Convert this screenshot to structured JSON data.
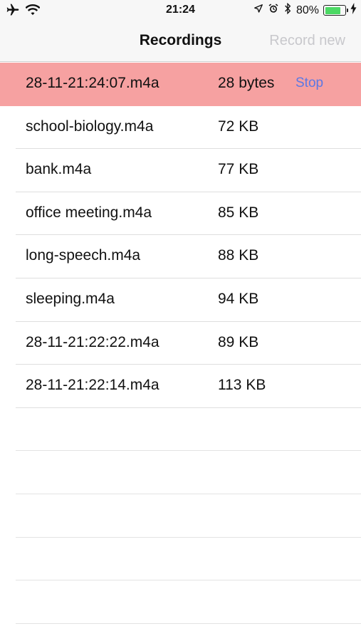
{
  "status_bar": {
    "time": "21:24",
    "battery_percent": "80%",
    "battery_level": 0.8,
    "icons_left": [
      "airplane-icon",
      "wifi-icon"
    ],
    "icons_right": [
      "location-arrow-icon",
      "alarm-icon",
      "bluetooth-icon",
      "charging-bolt-icon"
    ]
  },
  "nav": {
    "title": "Recordings",
    "right_button": "Record new"
  },
  "recordings": [
    {
      "name": "28-11-21:24:07.m4a",
      "size": "28 bytes",
      "action": "Stop",
      "active": true
    },
    {
      "name": "school-biology.m4a",
      "size": "72 KB"
    },
    {
      "name": "bank.m4a",
      "size": "77 KB"
    },
    {
      "name": "office meeting.m4a",
      "size": "85 KB"
    },
    {
      "name": "long-speech.m4a",
      "size": "88 KB"
    },
    {
      "name": "sleeping.m4a",
      "size": "94 KB"
    },
    {
      "name": "28-11-21:22:22.m4a",
      "size": "89 KB"
    },
    {
      "name": "28-11-21:22:14.m4a",
      "size": "113 KB"
    }
  ],
  "colors": {
    "active_row": "#f6a1a1",
    "link": "#5c78e4",
    "disabled": "#c8c8cc",
    "battery": "#4cd964"
  }
}
